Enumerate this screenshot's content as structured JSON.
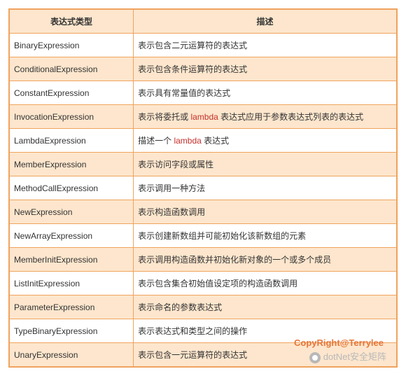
{
  "table": {
    "headers": {
      "name": "表达式类型",
      "desc": "描述"
    },
    "rows": [
      {
        "name": "BinaryExpression",
        "desc_pre": "表示包含二元运算符的表达式"
      },
      {
        "name": "ConditionalExpression",
        "desc_pre": "表示包含条件运算符的表达式"
      },
      {
        "name": "ConstantExpression",
        "desc_pre": "表示具有常量值的表达式"
      },
      {
        "name": "InvocationExpression",
        "desc_pre": "表示将委托或 ",
        "latin": "lambda",
        "desc_post": " 表达式应用于参数表达式列表的表达式"
      },
      {
        "name": "LambdaExpression",
        "desc_pre": "描述一个 ",
        "latin": "lambda",
        "desc_post": " 表达式"
      },
      {
        "name": "MemberExpression",
        "desc_pre": "表示访问字段或属性"
      },
      {
        "name": "MethodCallExpression",
        "desc_pre": "表示调用一种方法"
      },
      {
        "name": "NewExpression",
        "desc_pre": "表示构造函数调用"
      },
      {
        "name": "NewArrayExpression",
        "desc_pre": "表示创建新数组并可能初始化该新数组的元素"
      },
      {
        "name": "MemberInitExpression",
        "desc_pre": "表示调用构造函数并初始化新对象的一个或多个成员"
      },
      {
        "name": "ListInitExpression",
        "desc_pre": "表示包含集合初始值设定项的构造函数调用"
      },
      {
        "name": "ParameterExpression",
        "desc_pre": "表示命名的参数表达式"
      },
      {
        "name": "TypeBinaryExpression",
        "desc_pre": "表示表达式和类型之间的操作"
      },
      {
        "name": "UnaryExpression",
        "desc_pre": "表示包含一元运算符的表达式"
      }
    ]
  },
  "watermarks": {
    "copyright": "CopyRight@Terrylee",
    "channel": "dotNet安全矩阵"
  }
}
